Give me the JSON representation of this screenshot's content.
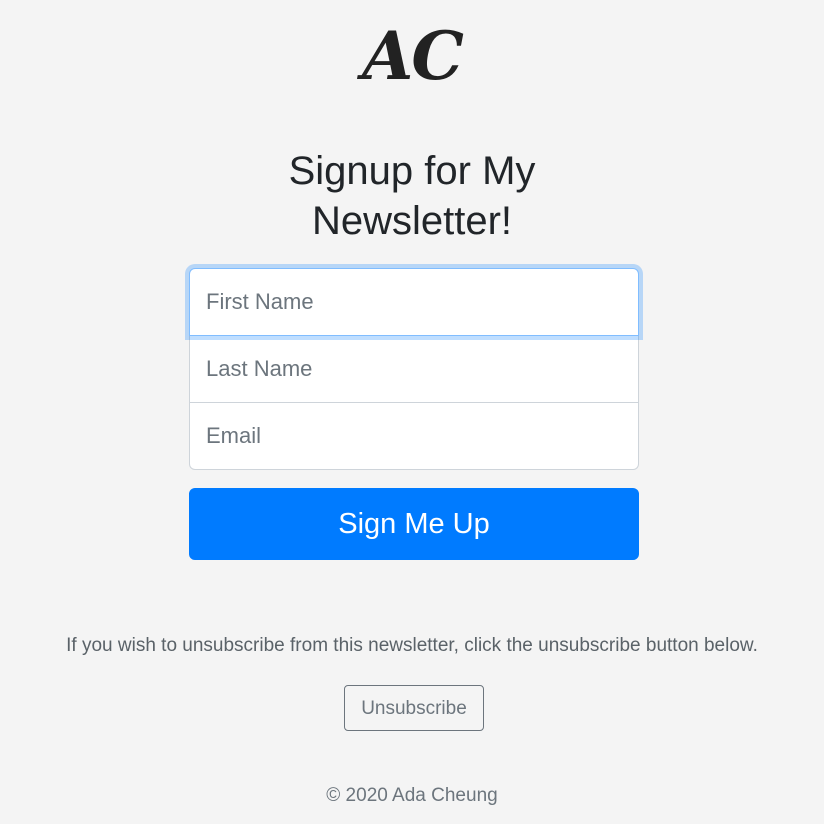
{
  "logo": {
    "text": "AC"
  },
  "heading": {
    "line1": "Signup for My",
    "line2": "Newsletter!"
  },
  "form": {
    "first_name_placeholder": "First Name",
    "last_name_placeholder": "Last Name",
    "email_placeholder": "Email",
    "first_name_value": "",
    "last_name_value": "",
    "email_value": "",
    "submit_label": "Sign Me Up"
  },
  "unsubscribe": {
    "message": "If you wish to unsubscribe from this newsletter, click the unsubscribe button below.",
    "button_label": "Unsubscribe"
  },
  "footer": {
    "copyright": "© 2020 Ada Cheung"
  },
  "colors": {
    "primary": "#007bff",
    "background": "#f4f4f4",
    "focus_border": "#80bdff",
    "muted": "#6c757d"
  }
}
